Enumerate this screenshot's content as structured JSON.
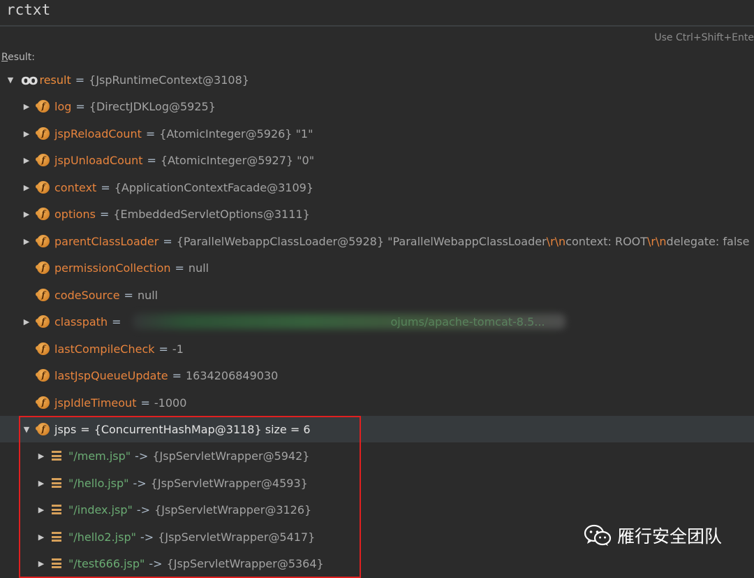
{
  "expression": "rctxt",
  "hint": "Use Ctrl+Shift+Ente",
  "result_label_first": "R",
  "result_label_rest": "esult:",
  "root": {
    "name": "result",
    "value": "{JspRuntimeContext@3108}"
  },
  "fields": [
    {
      "name": "log",
      "value": "{DirectJDKLog@5925}"
    },
    {
      "name": "jspReloadCount",
      "value": "{AtomicInteger@5926} \"1\""
    },
    {
      "name": "jspUnloadCount",
      "value": "{AtomicInteger@5927} \"0\""
    },
    {
      "name": "context",
      "value": "{ApplicationContextFacade@3109}"
    },
    {
      "name": "options",
      "value": "{EmbeddedServletOptions@3111}"
    },
    {
      "name": "parentClassLoader",
      "value_parts": [
        "{ParallelWebappClassLoader@5928} \"ParallelWebappClassLoader",
        "\\r\\n",
        "  context: ROOT",
        "\\r\\n",
        "  delegate: false"
      ]
    },
    {
      "name": "permissionCollection",
      "value": "null"
    },
    {
      "name": "codeSource",
      "value": "null"
    },
    {
      "name": "classpath",
      "value_visible": "ojums/apache-tomcat-8.5..."
    },
    {
      "name": "lastCompileCheck",
      "value": "-1"
    },
    {
      "name": "lastJspQueueUpdate",
      "value": "1634206849030"
    },
    {
      "name": "jspIdleTimeout",
      "value": "-1000"
    },
    {
      "name": "jsps",
      "value": "{ConcurrentHashMap@3118}  size = 6"
    }
  ],
  "jsp_entries": [
    {
      "key": "\"/mem.jsp\"",
      "arrow": "->",
      "value": "{JspServletWrapper@5942}"
    },
    {
      "key": "\"/hello.jsp\"",
      "arrow": "->",
      "value": "{JspServletWrapper@4593}"
    },
    {
      "key": "\"/index.jsp\"",
      "arrow": "->",
      "value": "{JspServletWrapper@3126}"
    },
    {
      "key": "\"/hello2.jsp\"",
      "arrow": "->",
      "value": "{JspServletWrapper@5417}"
    },
    {
      "key": "\"/test666.jsp\"",
      "arrow": "->",
      "value": "{JspServletWrapper@5364}"
    }
  ],
  "watermark": "雁行安全团队",
  "icons": {
    "field": "field-icon",
    "watch": "watch-infinity-icon",
    "entry": "map-entry-icon",
    "expand": "triangle-right-icon",
    "collapse": "triangle-down-icon"
  },
  "colors": {
    "background": "#2b2b2b",
    "field_name": "#e8843d",
    "string": "#6aab73",
    "value": "#a3a3a3",
    "highlight_box": "#e02020"
  }
}
